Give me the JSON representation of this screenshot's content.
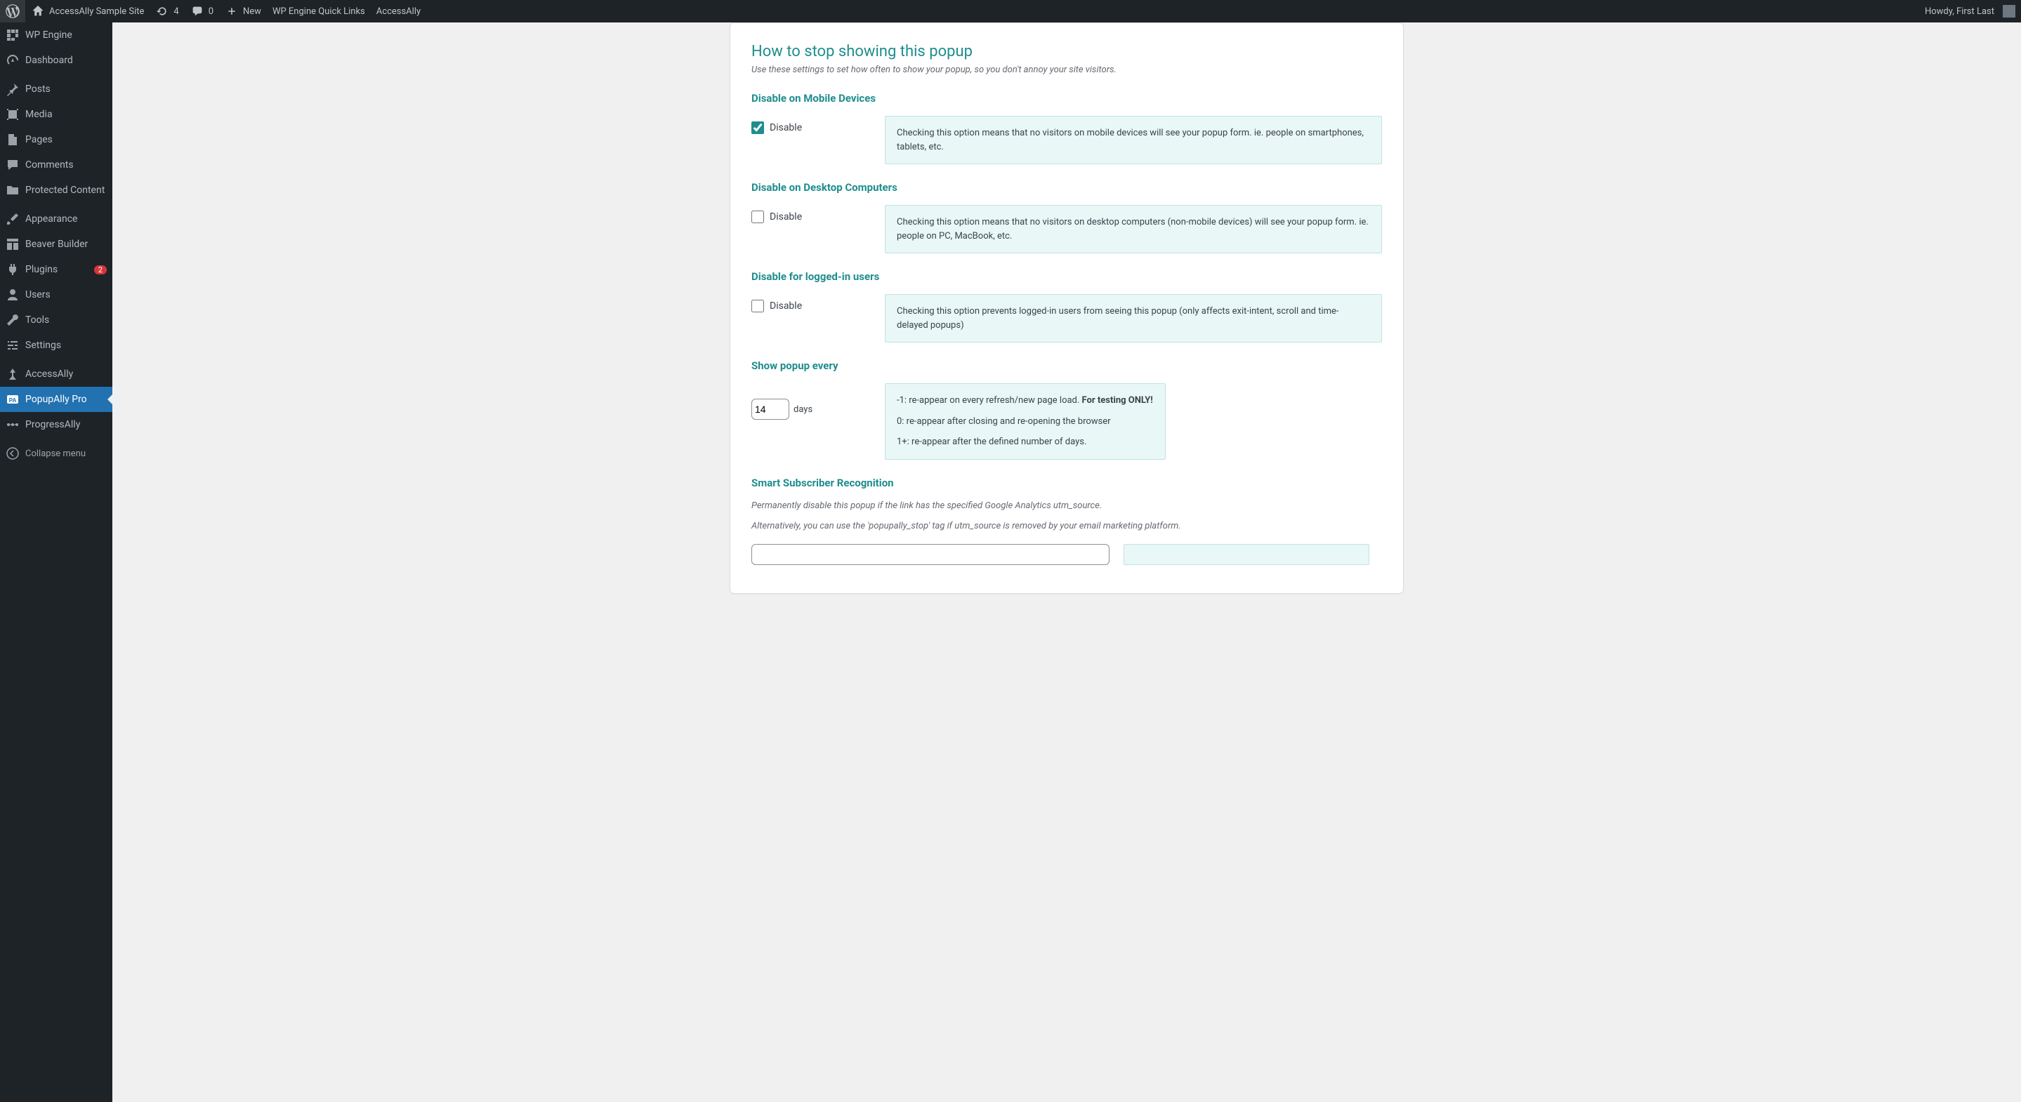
{
  "toolbar": {
    "site_name": "AccessAlly Sample Site",
    "refresh_count": "4",
    "comment_count": "0",
    "new_label": "New",
    "wp_engine": "WP Engine Quick Links",
    "accessally": "AccessAlly",
    "howdy": "Howdy, First Last"
  },
  "sidebar": {
    "items": [
      {
        "label": "WP Engine"
      },
      {
        "label": "Dashboard"
      },
      {
        "label": "Posts"
      },
      {
        "label": "Media"
      },
      {
        "label": "Pages"
      },
      {
        "label": "Comments"
      },
      {
        "label": "Protected Content"
      },
      {
        "label": "Appearance"
      },
      {
        "label": "Beaver Builder"
      },
      {
        "label": "Plugins",
        "badge": "2"
      },
      {
        "label": "Users"
      },
      {
        "label": "Tools"
      },
      {
        "label": "Settings"
      },
      {
        "label": "AccessAlly"
      },
      {
        "label": "PopupAlly Pro"
      },
      {
        "label": "ProgressAlly"
      },
      {
        "label": "Collapse menu"
      }
    ]
  },
  "main": {
    "heading": "How to stop showing this popup",
    "heading_desc": "Use these settings to set how often to show your popup, so you don't annoy your site visitors.",
    "mobile": {
      "title": "Disable on Mobile Devices",
      "label": "Disable",
      "help": "Checking this option means that no visitors on mobile devices will see your popup form. ie. people on smartphones, tablets, etc."
    },
    "desktop": {
      "title": "Disable on Desktop Computers",
      "label": "Disable",
      "help": "Checking this option means that no visitors on desktop computers (non-mobile devices) will see your popup form. ie. people on PC, MacBook, etc."
    },
    "loggedin": {
      "title": "Disable for logged-in users",
      "label": "Disable",
      "help": "Checking this option prevents logged-in users from seeing this popup (only affects exit-intent, scroll and time-delayed popups)"
    },
    "every": {
      "title": "Show popup every",
      "value": "14",
      "days_label": "days",
      "line1a": "-1: re-appear on every refresh/new page load. ",
      "line1b": "For testing ONLY!",
      "line2": "0: re-appear after closing and re-opening the browser",
      "line3": "1+: re-appear after the defined number of days."
    },
    "smart": {
      "title": "Smart Subscriber Recognition",
      "desc1": "Permanently disable this popup if the link has the specified Google Analytics utm_source.",
      "desc2": "Alternatively, you can use the 'popupally_stop' tag if utm_source is removed by your email marketing platform.",
      "utm_value": "",
      "utm_help": ""
    }
  }
}
